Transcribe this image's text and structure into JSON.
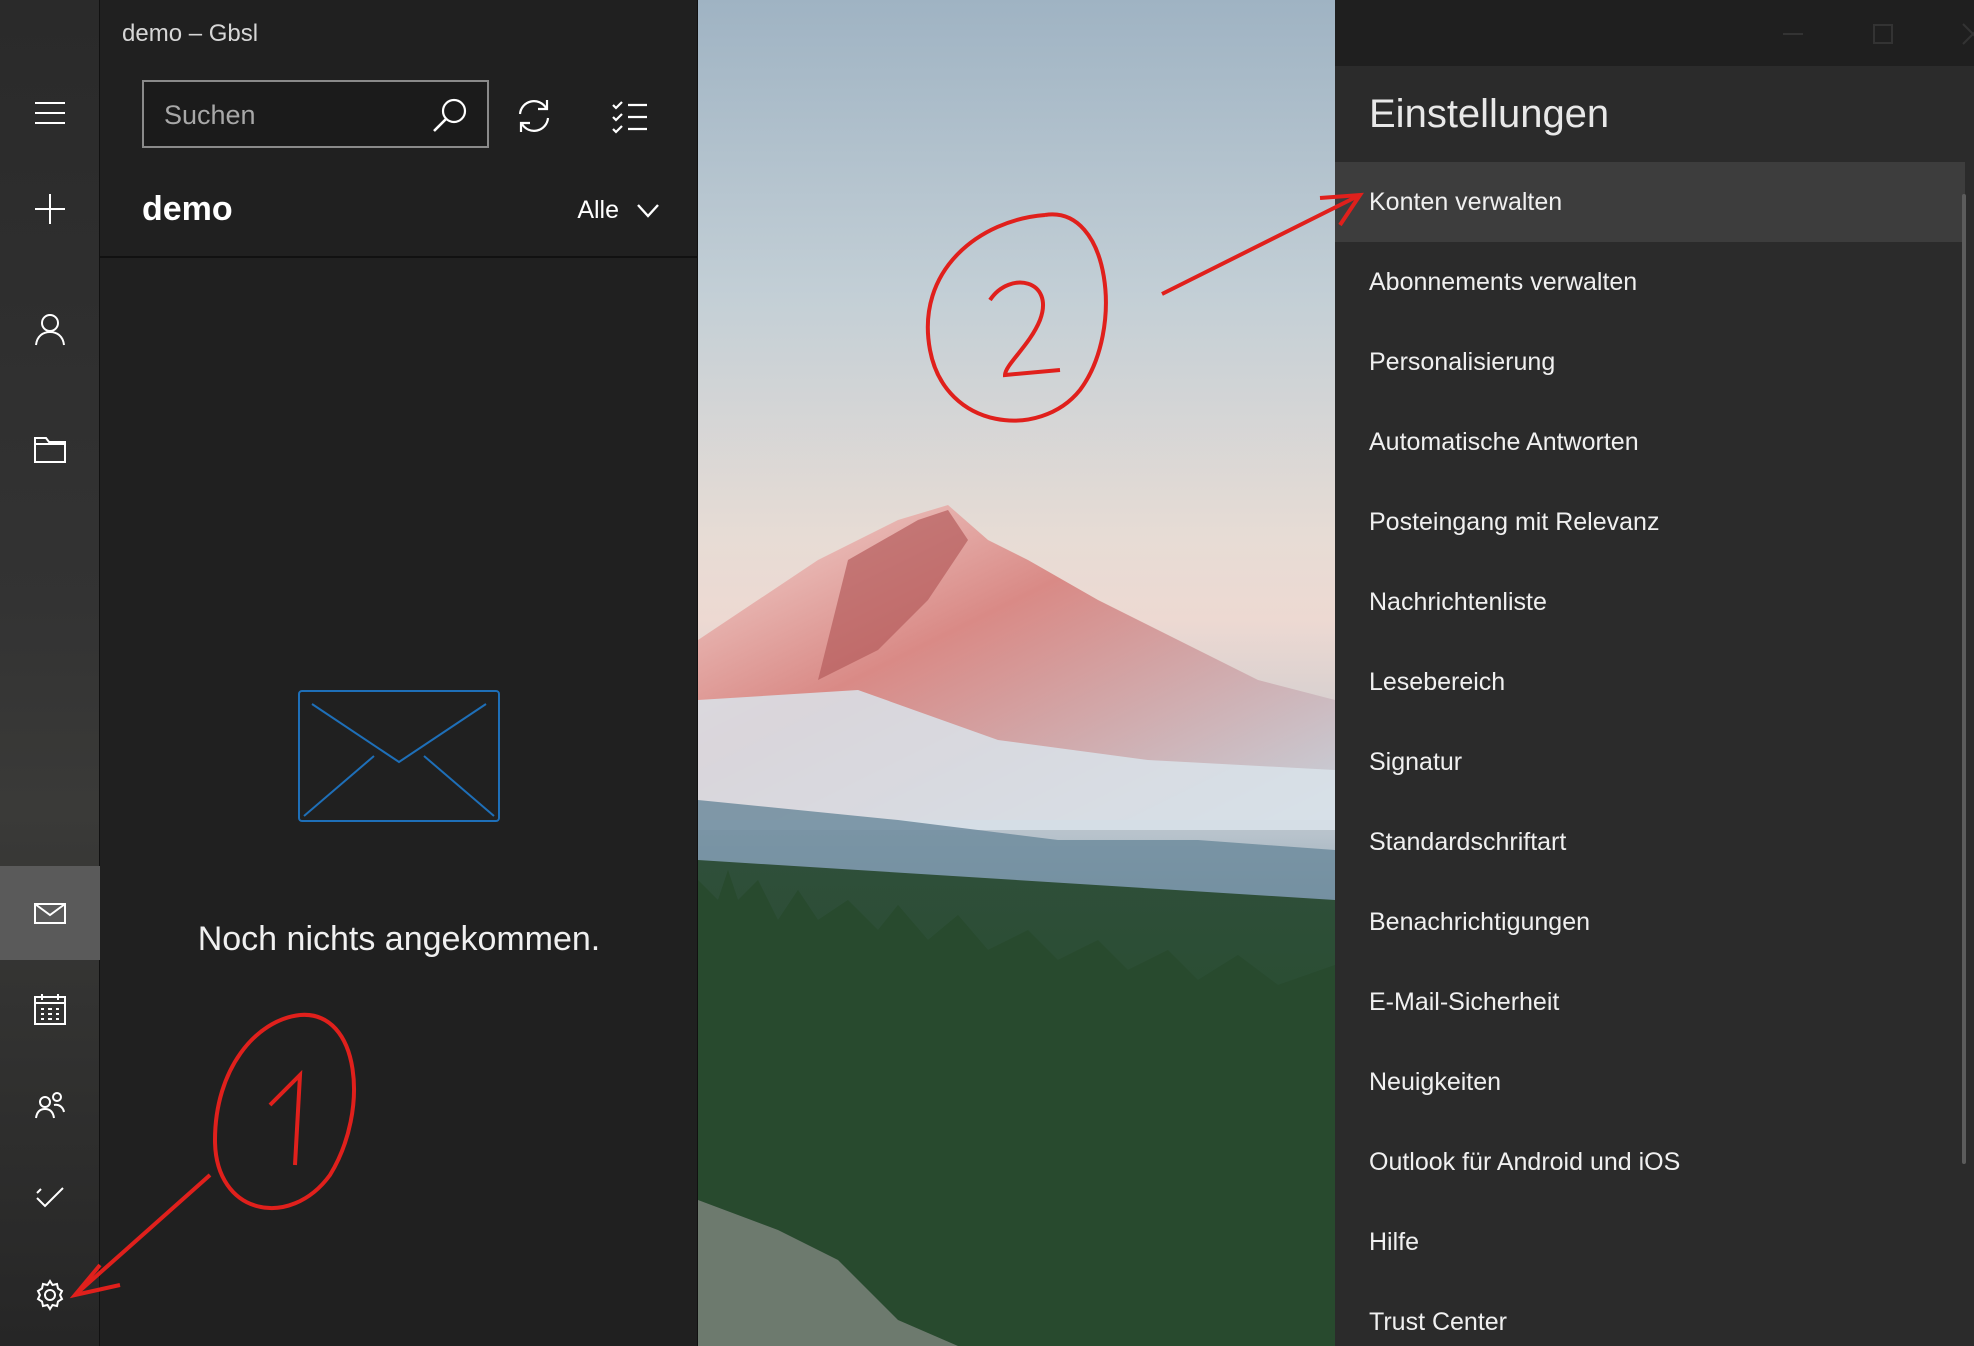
{
  "window": {
    "title": "demo – Gbsl",
    "controls": {
      "minimize": "minimize-icon",
      "maximize": "maximize-icon",
      "close": "close-icon"
    }
  },
  "rail": {
    "items": [
      {
        "name": "menu",
        "icon": "hamburger-icon"
      },
      {
        "name": "new-mail",
        "icon": "plus-icon"
      },
      {
        "name": "accounts",
        "icon": "person-icon"
      },
      {
        "name": "folders",
        "icon": "folder-icon"
      },
      {
        "name": "mail",
        "icon": "mail-icon",
        "active": true
      },
      {
        "name": "calendar",
        "icon": "calendar-icon"
      },
      {
        "name": "people",
        "icon": "people-icon"
      },
      {
        "name": "todo",
        "icon": "checkmark-icon"
      },
      {
        "name": "settings",
        "icon": "gear-icon"
      }
    ]
  },
  "list": {
    "search_placeholder": "Suchen",
    "folder_title": "demo",
    "filter_label": "Alle",
    "empty_message": "Noch nichts angekommen."
  },
  "settings": {
    "title": "Einstellungen",
    "items": [
      "Konten verwalten",
      "Abonnements verwalten",
      "Personalisierung",
      "Automatische Antworten",
      "Posteingang mit Relevanz",
      "Nachrichtenliste",
      "Lesebereich",
      "Signatur",
      "Standardschriftart",
      "Benachrichtigungen",
      "E-Mail-Sicherheit",
      "Neuigkeiten",
      "Outlook für Android und iOS",
      "Hilfe",
      "Trust Center"
    ]
  },
  "colors": {
    "annotation_red": "#e0201c",
    "accent_blue": "#1e6fb8"
  }
}
